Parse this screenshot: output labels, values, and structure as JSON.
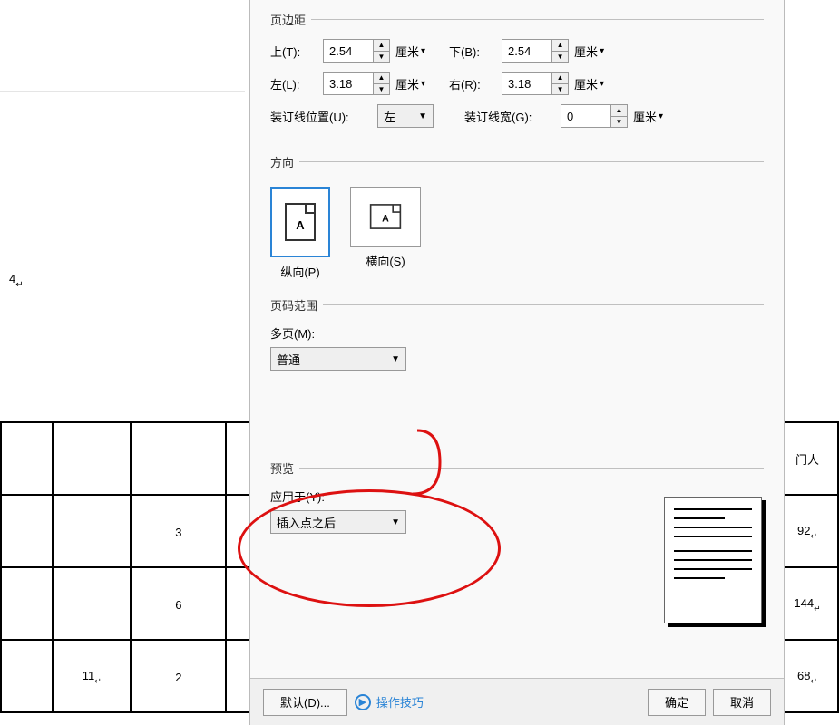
{
  "background": {
    "marker_text": "4",
    "header_right_cell": "门人",
    "rows": [
      {
        "c0": "",
        "c1": "",
        "c2": "",
        "right": ""
      },
      {
        "c0": "",
        "c1": "",
        "c2": "3",
        "right": "92"
      },
      {
        "c0": "",
        "c1": "",
        "c2": "6",
        "right": "144"
      },
      {
        "c0": "",
        "c1": "11",
        "c2": "2",
        "right": "68"
      }
    ]
  },
  "margins": {
    "legend": "页边距",
    "top_label": "上(T):",
    "top_value": "2.54",
    "bottom_label": "下(B):",
    "bottom_value": "2.54",
    "left_label": "左(L):",
    "left_value": "3.18",
    "right_label": "右(R):",
    "right_value": "3.18",
    "gutter_pos_label": "装订线位置(U):",
    "gutter_pos_value": "左",
    "gutter_width_label": "装订线宽(G):",
    "gutter_width_value": "0",
    "unit": "厘米"
  },
  "orientation": {
    "legend": "方向",
    "portrait_label": "纵向(P)",
    "landscape_label": "横向(S)"
  },
  "page_range": {
    "legend": "页码范围",
    "multipage_label": "多页(M):",
    "multipage_value": "普通"
  },
  "preview": {
    "legend": "预览",
    "apply_to_label": "应用于(Y):",
    "apply_to_value": "插入点之后"
  },
  "buttons": {
    "default": "默认(D)...",
    "tips": "操作技巧",
    "ok": "确定",
    "cancel": "取消"
  }
}
